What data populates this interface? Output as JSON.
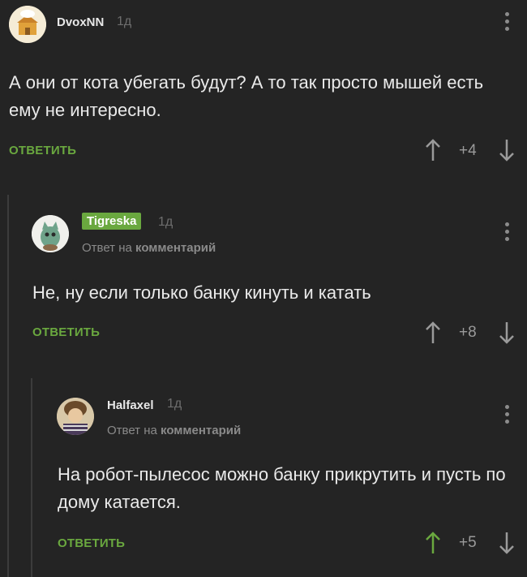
{
  "comments": [
    {
      "username": "DvoxNN",
      "time": "1д",
      "reply_to": null,
      "text": "А они от кота убегать будут? А то так просто мышей есть ему не интересно.",
      "reply_label": "ОТВЕТИТЬ",
      "score": "+4",
      "upvoted": false
    },
    {
      "username": "Tigreska",
      "time": "1д",
      "reply_prefix": "Ответ на",
      "reply_link": "комментарий",
      "text": "Не, ну если только банку кинуть и катать",
      "reply_label": "ОТВЕТИТЬ",
      "score": "+8",
      "upvoted": false
    },
    {
      "username": "Halfaxel",
      "time": "1д",
      "reply_prefix": "Ответ на",
      "reply_link": "комментарий",
      "text": "На робот-пылесос можно банку прикрутить и пусть по дому катается.",
      "reply_label": "ОТВЕТИТЬ",
      "score": "+5",
      "upvoted": true
    }
  ],
  "colors": {
    "background": "#242424",
    "accent": "#6aa83f",
    "muted": "#8a8a8a",
    "thread_line": "#3c3c3c"
  },
  "icons": {
    "upvote": "arrow-up-icon",
    "downvote": "arrow-down-icon",
    "more": "more-vertical-icon"
  }
}
